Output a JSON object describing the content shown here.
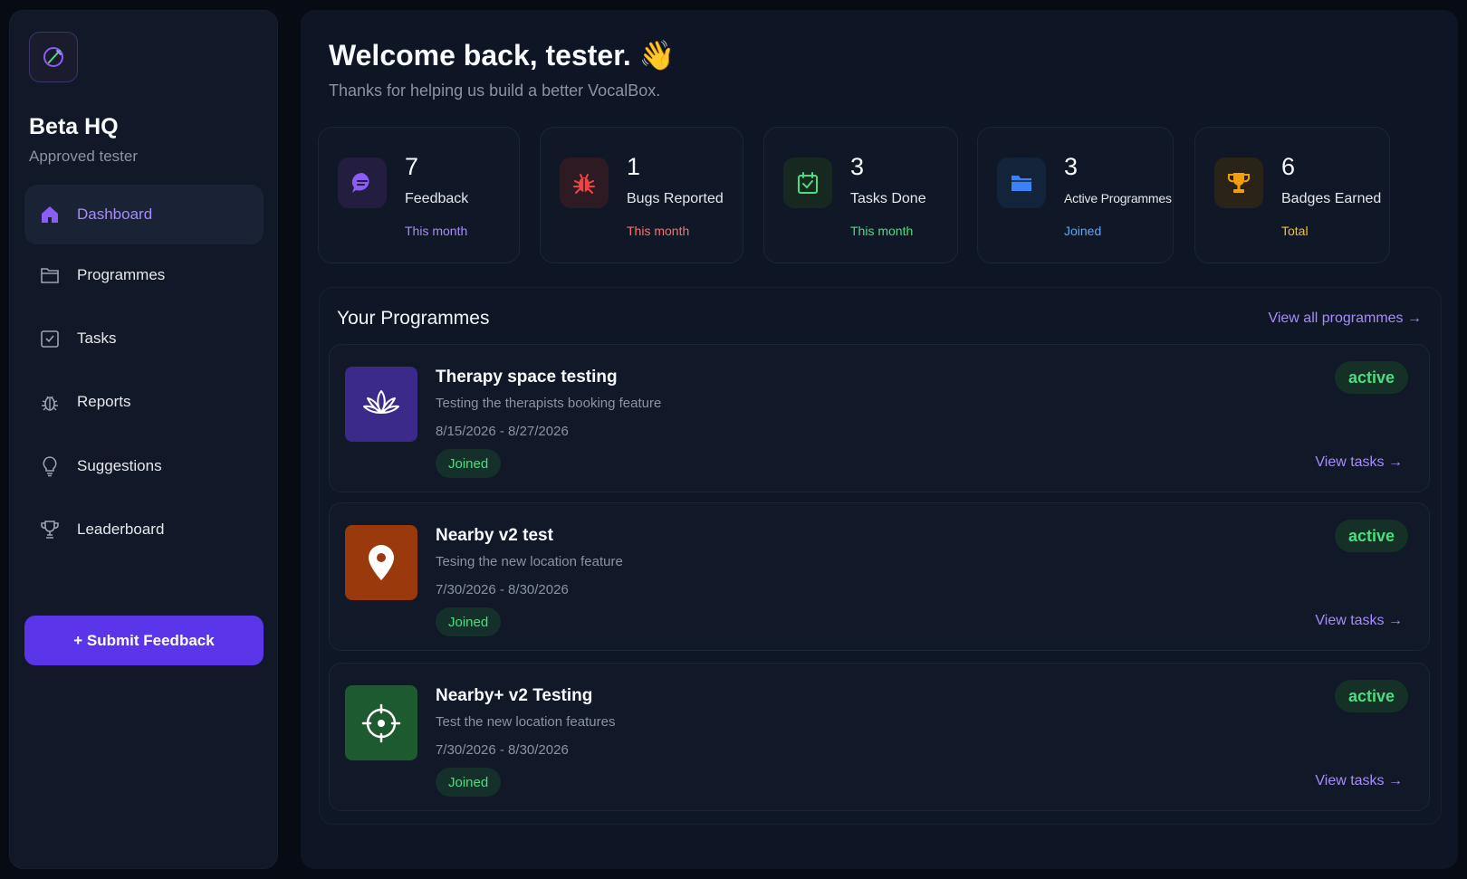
{
  "sidebar": {
    "brand_title": "Beta HQ",
    "brand_subtitle": "Approved tester",
    "items": [
      {
        "label": "Dashboard",
        "icon": "home-icon",
        "active": true
      },
      {
        "label": "Programmes",
        "icon": "folder-icon",
        "active": false
      },
      {
        "label": "Tasks",
        "icon": "checkbox-icon",
        "active": false
      },
      {
        "label": "Reports",
        "icon": "bug-icon",
        "active": false
      },
      {
        "label": "Suggestions",
        "icon": "lightbulb-icon",
        "active": false
      },
      {
        "label": "Leaderboard",
        "icon": "trophy-icon",
        "active": false
      }
    ],
    "submit_label": "+ Submit Feedback"
  },
  "main": {
    "welcome": "Welcome back, tester. 👋",
    "welcome_sub": "Thanks for helping us build a better VocalBox.",
    "stats": [
      {
        "value": "7",
        "label": "Feedback",
        "caption": "This month",
        "color": "#a78bfa",
        "icon": "chat-icon"
      },
      {
        "value": "1",
        "label": "Bugs Reported",
        "caption": "This month",
        "color": "#f87171",
        "icon": "bug-icon"
      },
      {
        "value": "3",
        "label": "Tasks Done",
        "caption": "This month",
        "color": "#4ade80",
        "icon": "calendar-check-icon"
      },
      {
        "value": "3",
        "label": "Active Programmes",
        "caption": "Joined",
        "color": "#60a5fa",
        "icon": "folder-icon"
      },
      {
        "value": "6",
        "label": "Badges Earned",
        "caption": "Total",
        "color": "#fbbf24",
        "icon": "trophy-icon"
      }
    ],
    "programmes": {
      "title": "Your Programmes",
      "view_all": "View all programmes →",
      "items": [
        {
          "name": "Therapy space testing",
          "description": "Testing the therapists booking feature",
          "dates": "8/15/2026 - 8/27/2026",
          "joined": "Joined",
          "status": "active",
          "view_tasks": "View tasks →",
          "icon": "lotus-icon",
          "icon_bg": "#3b2a8a"
        },
        {
          "name": "Nearby v2 test",
          "description": "Tesing the new location feature",
          "dates": "7/30/2026 - 8/30/2026",
          "joined": "Joined",
          "status": "active",
          "view_tasks": "View tasks →",
          "icon": "map-pin-icon",
          "icon_bg": "#9a3a0c"
        },
        {
          "name": "Nearby+ v2 Testing",
          "description": "Test the new location features",
          "dates": "7/30/2026 - 8/30/2026",
          "joined": "Joined",
          "status": "active",
          "view_tasks": "View tasks →",
          "icon": "crosshair-icon",
          "icon_bg": "#1e5a30"
        }
      ]
    }
  }
}
